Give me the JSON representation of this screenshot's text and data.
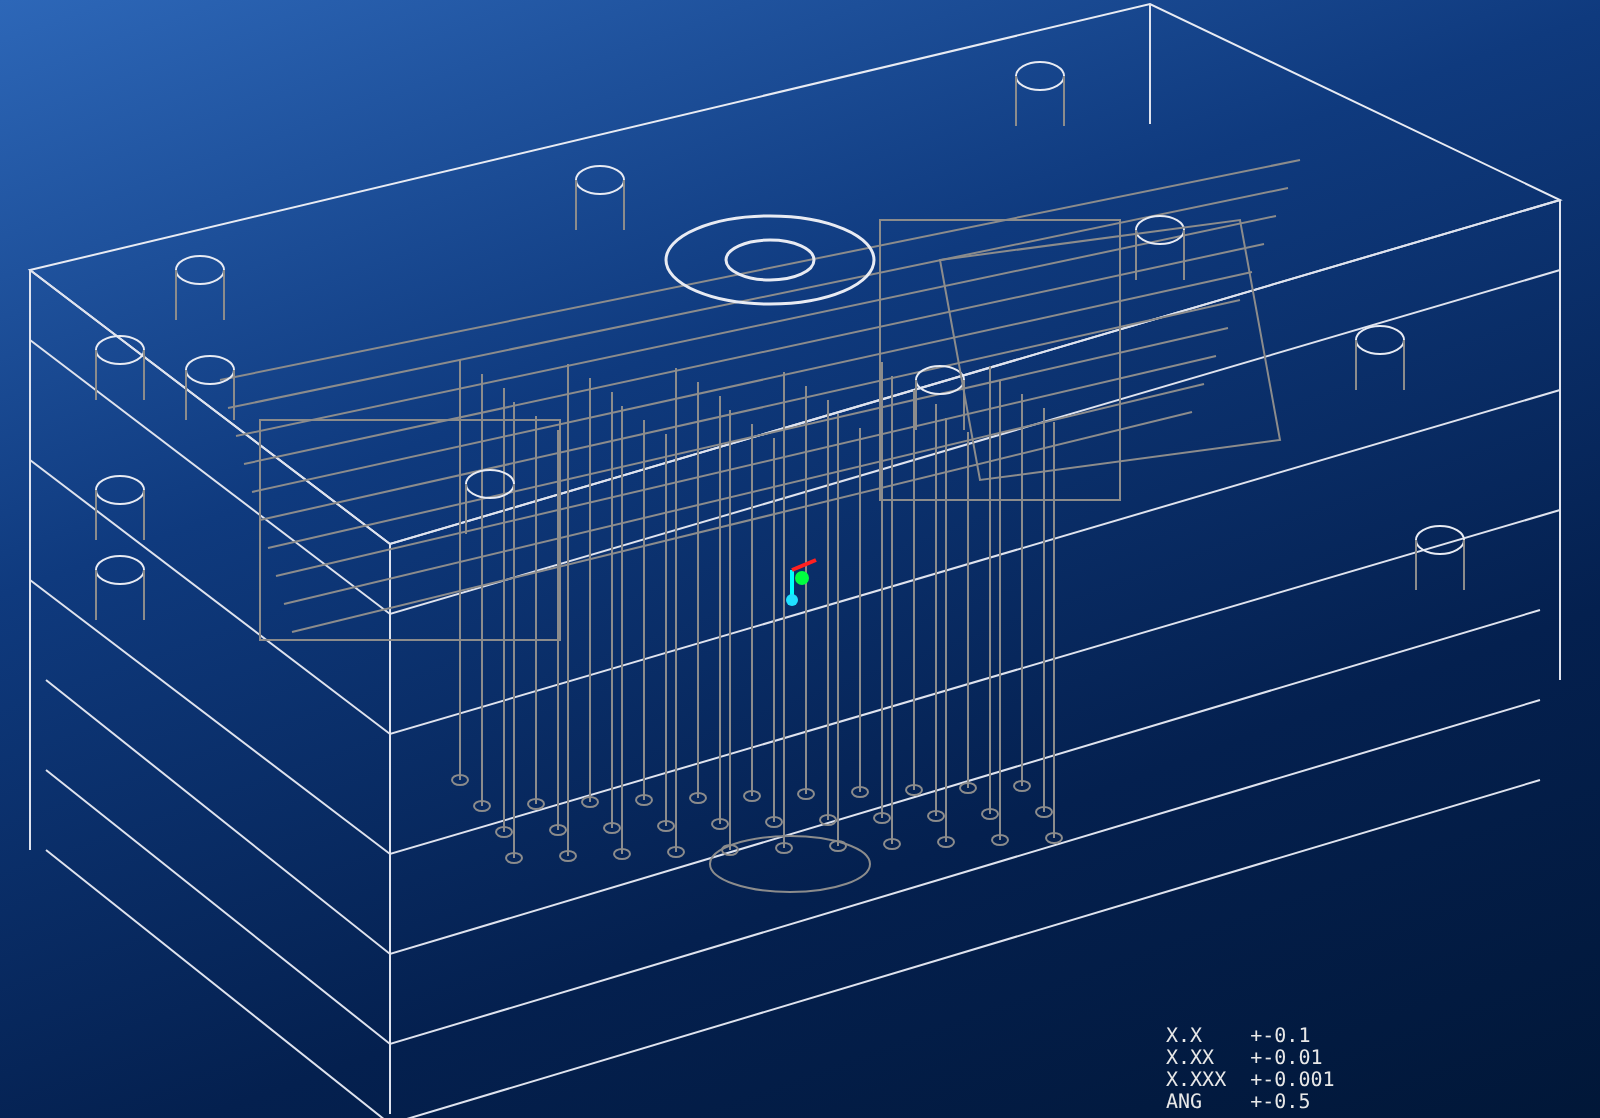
{
  "tolerances": [
    {
      "format": "X.X",
      "value": "+-0.1"
    },
    {
      "format": "X.XX",
      "value": "+-0.01"
    },
    {
      "format": "X.XXX",
      "value": "+-0.001"
    },
    {
      "format": "ANG",
      "value": "+-0.5"
    }
  ]
}
